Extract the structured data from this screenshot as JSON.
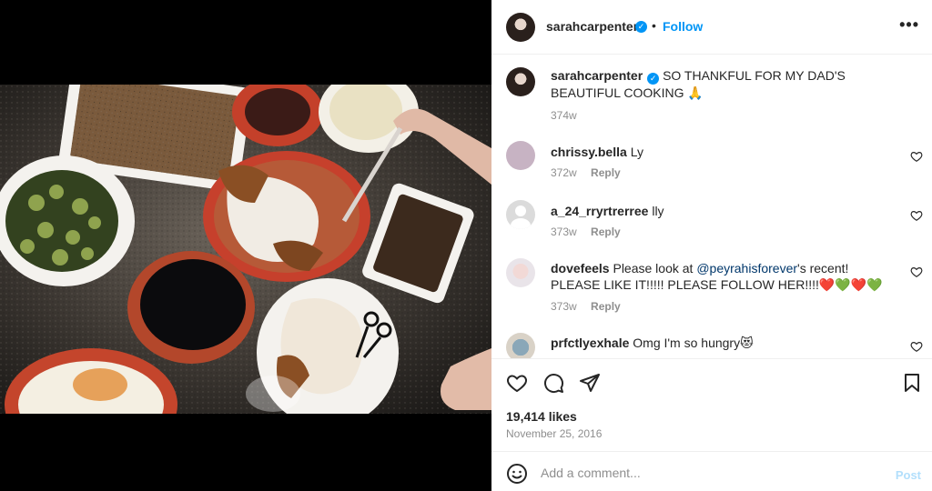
{
  "post": {
    "username": "sarahcarpenter",
    "follow_label": "Follow",
    "more_icon": "more-horizontal-icon",
    "verified_icon": "verified-badge-icon"
  },
  "caption": {
    "username": "sarahcarpenter",
    "text": "SO THANKFUL FOR MY DAD'S BEAUTIFUL COOKING 🙏",
    "time": "374w"
  },
  "comments": [
    {
      "username": "chrissy.bella",
      "text": "Ly",
      "time": "372w",
      "reply": "Reply"
    },
    {
      "username": "a_24_rryrtrerree",
      "text": "lly",
      "time": "373w",
      "reply": "Reply"
    },
    {
      "username": "dovefeels",
      "text_before": "Please look at ",
      "mention": "@peyrahisforever",
      "text_after": "'s recent! PLEASE LIKE IT!!!!! PLEASE FOLLOW HER!!!!❤️💚❤️💚",
      "time": "373w",
      "reply": "Reply"
    },
    {
      "username": "prfctlyexhale",
      "text": "Omg I'm so hungry😻"
    }
  ],
  "actions": {
    "likes": "19,414 likes",
    "date": "November 25, 2016"
  },
  "composer": {
    "placeholder": "Add a comment...",
    "post_label": "Post"
  },
  "colors": {
    "accent": "#0095f6",
    "post_disabled": "#b2dffc",
    "muted": "#8e8e8e"
  }
}
